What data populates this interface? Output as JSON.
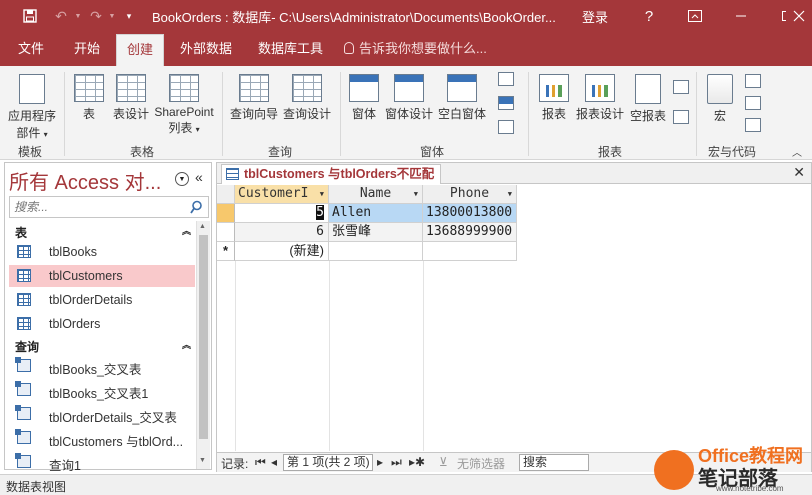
{
  "app": {
    "window_title": "BookOrders : 数据库- C:\\Users\\Administrator\\Documents\\BookOrder...",
    "login": "登录",
    "help": "?",
    "accent": "#a4373a"
  },
  "tabs": [
    "文件",
    "开始",
    "创建",
    "外部数据",
    "数据库工具"
  ],
  "active_tab": "创建",
  "tell_me": "告诉我你想要做什么...",
  "ribbon": {
    "groups": [
      {
        "label": "模板",
        "buttons": [
          "应用程序",
          "部件"
        ]
      },
      {
        "label": "表格",
        "buttons": [
          "表",
          "表设计",
          "SharePoint",
          "列表"
        ]
      },
      {
        "label": "查询",
        "buttons": [
          "查询向导",
          "查询设计"
        ]
      },
      {
        "label": "窗体",
        "buttons": [
          "窗体",
          "窗体设计",
          "空白窗体"
        ]
      },
      {
        "label": "报表",
        "buttons": [
          "报表",
          "报表设计",
          "空报表"
        ]
      },
      {
        "label": "宏与代码",
        "buttons": [
          "宏"
        ]
      }
    ]
  },
  "nav": {
    "title": "所有 Access 对...",
    "search_placeholder": "搜索...",
    "sections": [
      {
        "name": "表",
        "items": [
          "tblBooks",
          "tblCustomers",
          "tblOrderDetails",
          "tblOrders"
        ]
      },
      {
        "name": "查询",
        "items": [
          "tblBooks_交叉表",
          "tblBooks_交叉表1",
          "tblOrderDetails_交叉表",
          "tblCustomers 与tblOrd...",
          "查询1"
        ]
      }
    ],
    "selected_item": "tblCustomers"
  },
  "document": {
    "tab_title": "tblCustomers 与tblOrders不匹配",
    "columns": [
      "CustomerI",
      "Name",
      "Phone"
    ],
    "rows": [
      {
        "id": "5",
        "name": "Allen",
        "phone": "13800013800"
      },
      {
        "id": "6",
        "name": "张雪峰",
        "phone": "13688999900"
      }
    ],
    "new_row_marker": "*",
    "new_row_label": "(新建)"
  },
  "record_nav": {
    "label": "记录:",
    "position": "第 1 项(共 2 项)",
    "filter": "无筛选器",
    "search": "搜索"
  },
  "status": {
    "text": "数据表视图"
  },
  "watermark": {
    "brand_top": "Office教程网",
    "brand_bottom": "笔记部落",
    "url": "www.notetribe.com"
  }
}
